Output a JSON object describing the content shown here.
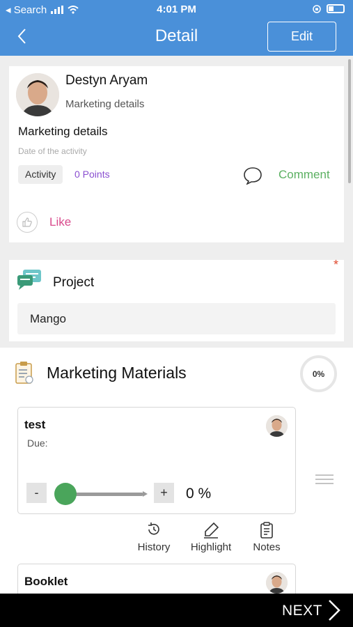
{
  "status_bar": {
    "back_app": "Search",
    "time": "4:01 PM"
  },
  "header": {
    "title": "Detail",
    "edit_label": "Edit"
  },
  "post": {
    "author": "Destyn Aryam",
    "subtitle": "Marketing details",
    "title": "Marketing details",
    "date_placeholder": "Date of the activity",
    "badge": "Activity",
    "points": "0 Points",
    "comment_label": "Comment",
    "like_label": "Like"
  },
  "project": {
    "required_mark": "*",
    "label": "Project",
    "value": "Mango"
  },
  "materials": {
    "title": "Marketing Materials",
    "progress_text": "0%",
    "tasks": [
      {
        "name": "test",
        "due": "Due:",
        "progress_text": "0 %",
        "progress": 0,
        "minus": "-",
        "plus": "+"
      },
      {
        "name": "Booklet"
      }
    ],
    "actions": {
      "history": "History",
      "highlight": "Highlight",
      "notes": "Notes"
    }
  },
  "footer": {
    "next_label": "NEXT"
  },
  "colors": {
    "header": "#4a90d9",
    "points": "#8a4fd0",
    "comment": "#5bb061",
    "like": "#d94a8c",
    "slider_thumb": "#4aa55b",
    "required": "#e04a2f"
  },
  "icons": [
    "wifi-icon",
    "signal-icon",
    "battery-icon",
    "back-chevron-icon",
    "comment-icon",
    "thumbs-up-icon",
    "chat-bubbles-icon",
    "clipboard-icon",
    "history-icon",
    "highlight-pen-icon",
    "notes-icon",
    "drag-handle-icon",
    "next-chevron-icon"
  ]
}
